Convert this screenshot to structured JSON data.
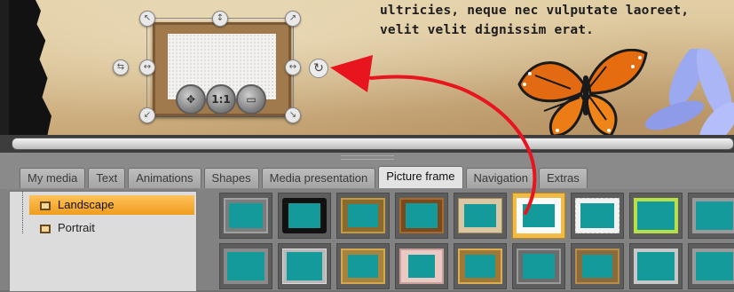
{
  "page": {
    "text_line_1": "ultricies, neque nec vulputate laoreet,",
    "text_line_2": "velit velit dignissim erat."
  },
  "selection_tools": {
    "move_icon": "move-icon",
    "ratio_label": "1:1",
    "layer_icon": "layer-icon",
    "rotate_icon": "rotate-icon"
  },
  "tabs": [
    {
      "label": "My media",
      "active": false
    },
    {
      "label": "Text",
      "active": false
    },
    {
      "label": "Animations",
      "active": false
    },
    {
      "label": "Shapes",
      "active": false
    },
    {
      "label": "Media presentation",
      "active": false
    },
    {
      "label": "Picture frame",
      "active": true
    },
    {
      "label": "Navigation",
      "active": false
    },
    {
      "label": "Extras",
      "active": false
    }
  ],
  "categories": [
    {
      "label": "Landscape",
      "selected": true
    },
    {
      "label": "Portrait",
      "selected": false
    }
  ],
  "thumbnails": {
    "row1_styles": [
      "bevel-grey",
      "torn-black",
      "ornate-gold",
      "wood-brown",
      "beige-mat",
      "white-torn",
      "white-ragged",
      "green-lime",
      "plain-grey"
    ],
    "row2_styles": [
      "plain-grey",
      "silver",
      "gold-ornate",
      "pink-mat",
      "gold-ornate",
      "silver-dark",
      "ornate-bronze",
      "grey-light",
      "plain-grey"
    ],
    "selected_index": 5
  },
  "colors": {
    "accent_orange": "#f2a629",
    "arrow_red": "#e8141e",
    "teal_picture": "#159a9b"
  }
}
